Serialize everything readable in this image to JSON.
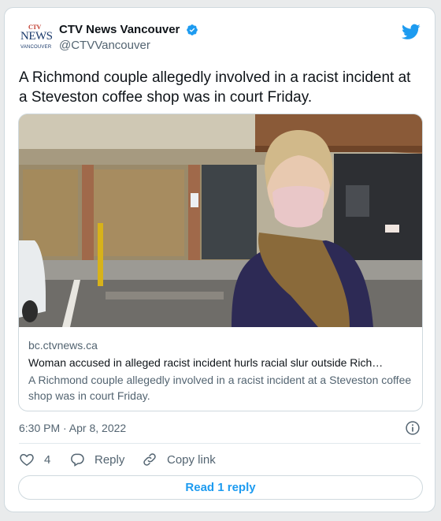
{
  "author": {
    "logo_text": {
      "ctv": "CTV",
      "news": "NEWS",
      "city": "VANCOUVER"
    },
    "display_name": "CTV News Vancouver",
    "handle": "@CTVVancouver",
    "verified": true,
    "verified_color": "#1d9bf0"
  },
  "brand_icon": "twitter-bird-icon",
  "brand_color": "#1d9bf0",
  "tweet": {
    "text": "A Richmond couple allegedly involved in a racist incident at a Steveston coffee shop was in court Friday."
  },
  "link_card": {
    "domain": "bc.ctvnews.ca",
    "title": "Woman accused in alleged racist incident hurls racial slur outside Rich…",
    "description": "A Richmond couple allegedly involved in a racist incident at a Steveston coffee shop was in court Friday."
  },
  "meta": {
    "timestamp": "6:30 PM · Apr 8, 2022",
    "info_icon": "info-icon"
  },
  "actions": {
    "like_count": "4",
    "reply_label": "Reply",
    "copy_label": "Copy link"
  },
  "read_replies_label": "Read 1 reply"
}
